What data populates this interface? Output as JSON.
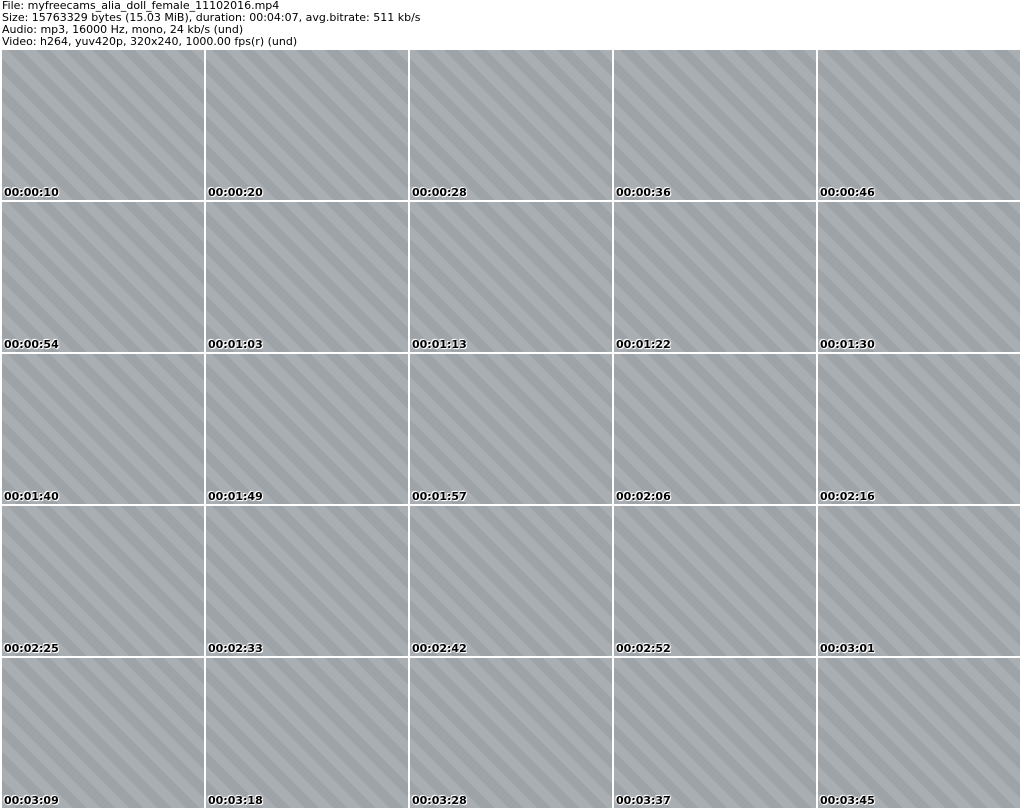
{
  "header": {
    "file": "File: myfreecams_alia_doll_female_11102016.mp4",
    "size": "Size: 15763329 bytes (15.03 MiB), duration: 00:04:07, avg.bitrate: 511 kb/s",
    "audio": "Audio: mp3, 16000 Hz, mono, 24 kb/s (und)",
    "video": "Video: h264, yuv420p, 320x240, 1000.00 fps(r) (und)"
  },
  "timestamps": [
    "00:00:10",
    "00:00:20",
    "00:00:28",
    "00:00:36",
    "00:00:46",
    "00:00:54",
    "00:01:03",
    "00:01:13",
    "00:01:22",
    "00:01:30",
    "00:01:40",
    "00:01:49",
    "00:01:57",
    "00:02:06",
    "00:02:16",
    "00:02:25",
    "00:02:33",
    "00:02:42",
    "00:02:52",
    "00:03:01",
    "00:03:09",
    "00:03:18",
    "00:03:28",
    "00:03:37",
    "00:03:45"
  ]
}
